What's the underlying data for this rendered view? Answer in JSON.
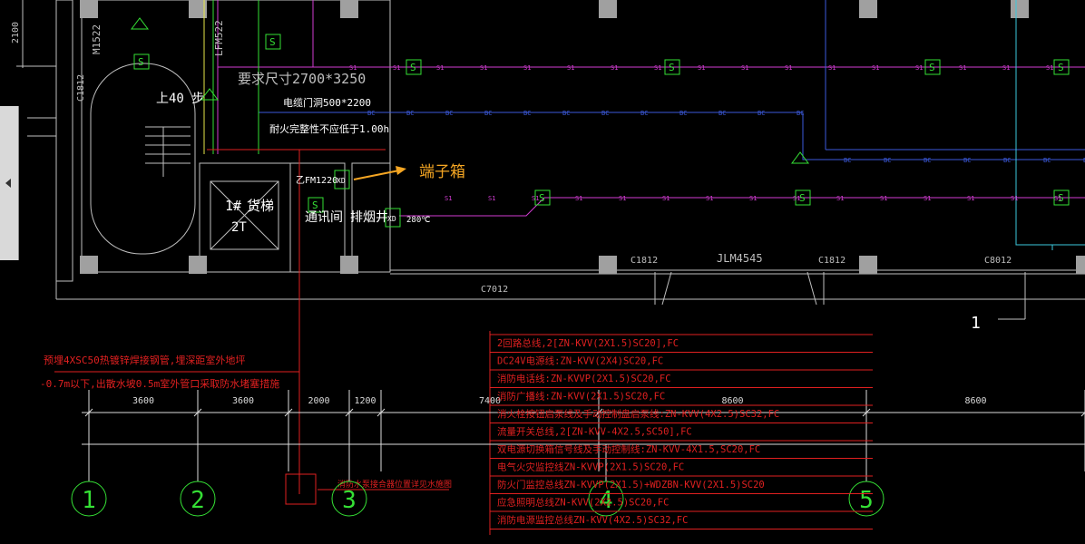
{
  "callout": {
    "text": "端子箱",
    "color": "#f5a623"
  },
  "rooms": {
    "stair_up": "上40 步",
    "elevator_num": "1#",
    "elevator_name": "货梯",
    "elevator_code": "2T",
    "comm_room": "通讯间",
    "smoke_shaft": "排烟井",
    "door_fm": "乙FM1220"
  },
  "notes": {
    "size_req": "要求尺寸2700*3250",
    "shaft_door": "电缆门洞500*2200",
    "fire_rating": "耐火完整性不应低于1.00h",
    "temp": "280℃",
    "pipe_note_line1": "预埋4XSC50热镀锌焊接钢管,埋深距室外地坪",
    "pipe_note_line2": "-0.7m以下,出散水坡0.5m室外管口采取防水堵塞措施",
    "inlet_box_note": "消防水泵接合器位置详见水施图"
  },
  "door_labels": {
    "left1": "M1522",
    "left2": "LFM522",
    "wall_c": "C1812",
    "wall_c2": "C1812",
    "wall_c3": "C8012",
    "wall_c4": "C7012",
    "jlm": "JLM4545",
    "height": "2100",
    "plan_num": "1",
    "left_c": "C1812"
  },
  "line_tags": {
    "s": "S1",
    "bc": "BC",
    "s_symbol": "S",
    "sd": "SD",
    "xd": "XD"
  },
  "dimensions": [
    "3600",
    "3600",
    "2000",
    "1200",
    "7400",
    "8600",
    "8600"
  ],
  "axes": [
    "1",
    "2",
    "3",
    "4",
    "5"
  ],
  "legend": [
    "2回路总线,2[ZN-KVV(2X1.5)SC20],FC",
    "DC24V电源线:ZN-KVV(2X4)SC20,FC",
    "消防电话线:ZN-KVVP(2X1.5)SC20,FC",
    "消防广播线:ZN-KVV(2X1.5)SC20,FC",
    "消火栓按钮启泵线及手动控制盘启泵线:ZN-KVV(4X2.5)SC32,FC",
    "流量开关总线,2[ZN-KVV-4X2.5,SC50],FC",
    "双电源切换箱信号线及手动控制线:ZN-KVV-4X1.5,SC20,FC",
    "电气火灾监控线ZN-KVVP(2X1.5)SC20,FC",
    "防火门监控总线ZN-KVVP(2X1.5)+WDZBN-KVV(2X1.5)SC20",
    "应急照明总线ZN-KVV(2X2.5)SC20,FC",
    "消防电源监控总线ZN-KVV(4X2.5)SC32,FC"
  ],
  "colors": {
    "wall": "#bfbfbf",
    "magenta": "#d23cd2",
    "blue": "#3c5adc",
    "red": "#e02020",
    "green": "#35e035",
    "yellow": "#e6e64a",
    "cyan": "#3cc8dc",
    "dim": "#dcdcdc"
  }
}
